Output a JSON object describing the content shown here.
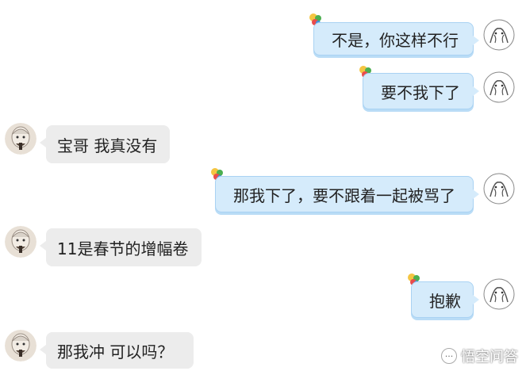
{
  "messages": [
    {
      "side": "right",
      "text": "不是，你这样不行"
    },
    {
      "side": "right",
      "text": "要不我下了"
    },
    {
      "side": "left",
      "text": "宝哥 我真没有"
    },
    {
      "side": "right",
      "text": "那我下了，要不跟着一起被骂了"
    },
    {
      "side": "left",
      "text": "11是春节的增幅卷"
    },
    {
      "side": "right",
      "text": "抱歉"
    },
    {
      "side": "left",
      "text": "那我冲  可以吗？"
    }
  ],
  "watermark": {
    "text": "悟空问答",
    "icon": "chat-bubble-icon"
  },
  "colors": {
    "right_bubble": "#d5ebfb",
    "right_border": "#a9d2f3",
    "left_bubble": "#ececec"
  }
}
